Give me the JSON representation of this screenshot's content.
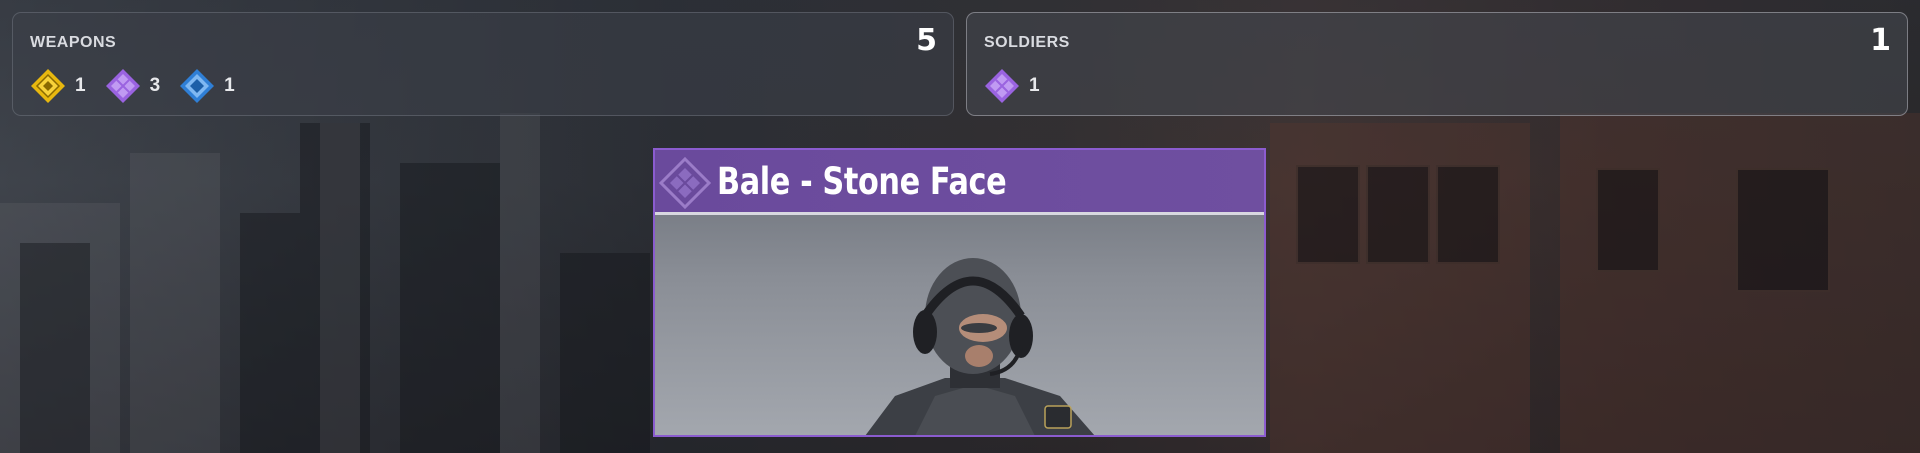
{
  "weapons": {
    "title": "WEAPONS",
    "total": "5",
    "rarities": [
      {
        "name": "legendary",
        "color": "#f2c31a",
        "count": "1"
      },
      {
        "name": "epic",
        "color": "#a76be8",
        "count": "3"
      },
      {
        "name": "rare",
        "color": "#3d8fe0",
        "count": "1"
      }
    ]
  },
  "soldiers": {
    "title": "SOLDIERS",
    "total": "1",
    "rarities": [
      {
        "name": "epic",
        "color": "#a76be8",
        "count": "1"
      }
    ]
  },
  "card": {
    "title": "Bale - Stone Face",
    "rarity_icon": "epic-rarity-icon",
    "accent": "#8b5ccf"
  }
}
